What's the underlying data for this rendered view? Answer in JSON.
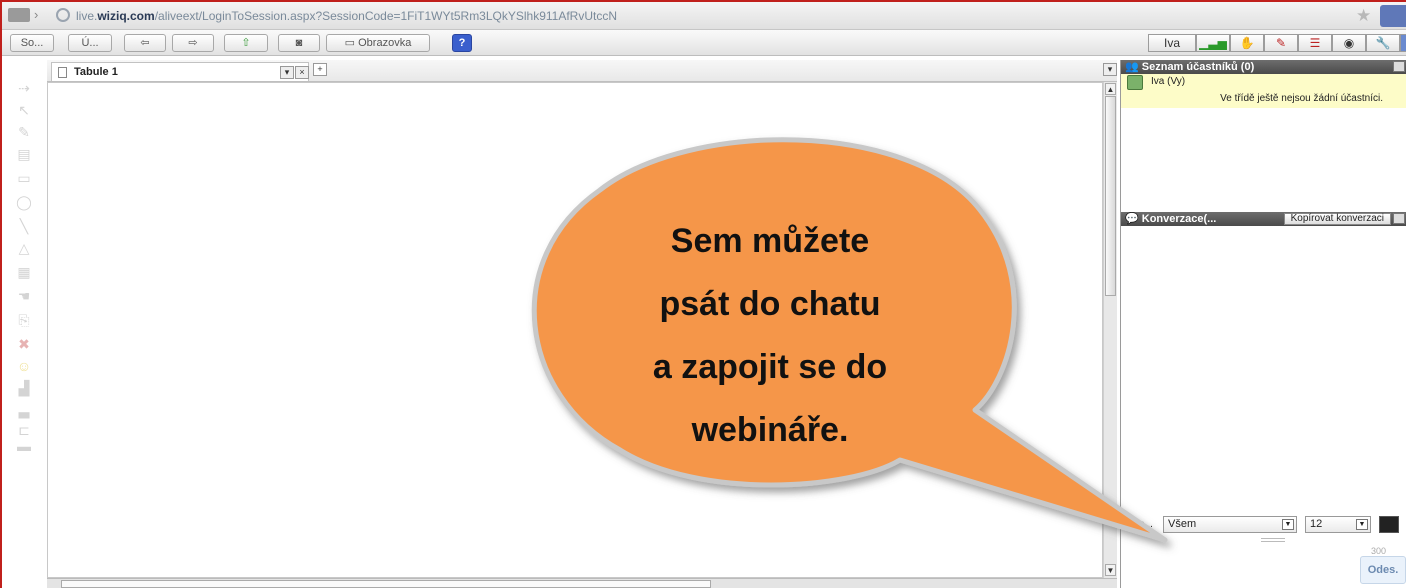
{
  "browser": {
    "url_prefix": "live.",
    "url_domain": "wiziq.com",
    "url_path": "/aliveext/LoginToSession.aspx?SessionCode=1FiT1WYt5Rm3LQkYSlhk911AfRvUtccN"
  },
  "toolbar": {
    "btn1": "So...",
    "btn2": "Ú...",
    "screen_label": "Obrazovka",
    "help": "?",
    "user_name": "Iva"
  },
  "board": {
    "tab_label": "Tabule 1",
    "add_tab": "+"
  },
  "participants": {
    "title": "Seznam účastníků (0)",
    "me": "Iva (Vy)",
    "note": "Ve třídě ještě nejsou žádní účastníci."
  },
  "chat": {
    "title": "Konverzace(...",
    "copy_label": "Kopírovat konverzaci",
    "to_label": "o...",
    "recipient": "Všem",
    "font_size": "12",
    "char_count": "300",
    "send_label": "Odes."
  },
  "callout": {
    "lines": [
      "Sem můžete",
      "psát do chatu",
      "a zapojit se do",
      "webináře."
    ],
    "fill_color": "#f5964a",
    "stroke_color": "#c8c8c8"
  }
}
